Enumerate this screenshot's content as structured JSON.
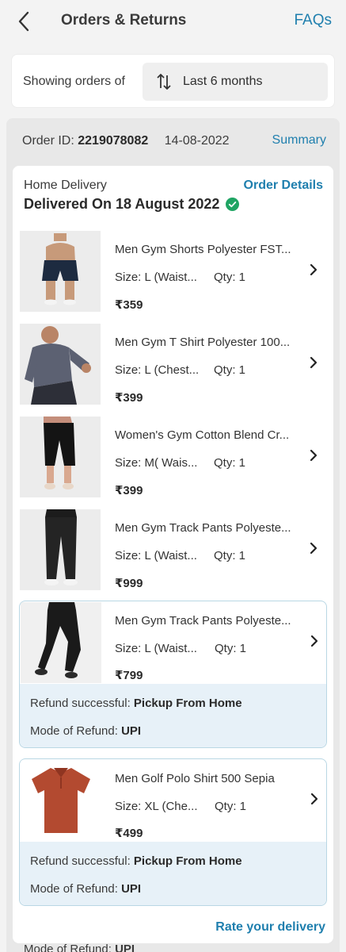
{
  "header": {
    "title": "Orders & Returns",
    "faqs_label": "FAQs"
  },
  "filter": {
    "label": "Showing orders of",
    "value": "Last 6 months"
  },
  "order": {
    "id_label": "Order ID:",
    "id": "2219078082",
    "date": "14-08-2022",
    "summary_label": "Summary",
    "delivery_type": "Home Delivery",
    "order_details_label": "Order Details",
    "status": "Delivered On 18 August 2022",
    "rate_label": "Rate your delivery"
  },
  "items": [
    {
      "name": "Men Gym Shorts Polyester FST...",
      "size": "Size: L (Waist...",
      "qty": "Qty: 1",
      "price": "₹359",
      "icon": "shorts-thumbnail"
    },
    {
      "name": "Men Gym T Shirt Polyester 100...",
      "size": "Size: L (Chest...",
      "qty": "Qty: 1",
      "price": "₹399",
      "icon": "tshirt-thumbnail"
    },
    {
      "name": "Women's Gym Cotton Blend Cr...",
      "size": "Size: M( Wais...",
      "qty": "Qty: 1",
      "price": "₹399",
      "icon": "capri-thumbnail"
    },
    {
      "name": "Men Gym Track Pants Polyeste...",
      "size": "Size: L (Waist...",
      "qty": "Qty: 1",
      "price": "₹999",
      "icon": "trackpants-thumbnail"
    }
  ],
  "returned_items": [
    {
      "name": "Men Gym Track Pants Polyeste...",
      "size": "Size: L (Waist...",
      "qty": "Qty: 1",
      "price": "₹799",
      "refund_label": "Refund successful:",
      "refund_value": "Pickup From Home",
      "mode_label": "Mode of Refund:",
      "mode_value": "UPI",
      "icon": "trackpants-thumbnail"
    },
    {
      "name": "Men Golf Polo Shirt 500 Sepia",
      "size": "Size: XL (Che...",
      "qty": "Qty: 1",
      "price": "₹499",
      "refund_label": "Refund successful:",
      "refund_value": "Pickup From Home",
      "mode_label": "Mode of Refund:",
      "mode_value": "UPI",
      "icon": "polo-thumbnail"
    }
  ],
  "peek": {
    "mode_label": "Mode of Refund:",
    "mode_value": "UPI"
  },
  "colors": {
    "accent": "#1f7fae",
    "success": "#1fa463",
    "refund_bg": "#e7f1f8"
  }
}
